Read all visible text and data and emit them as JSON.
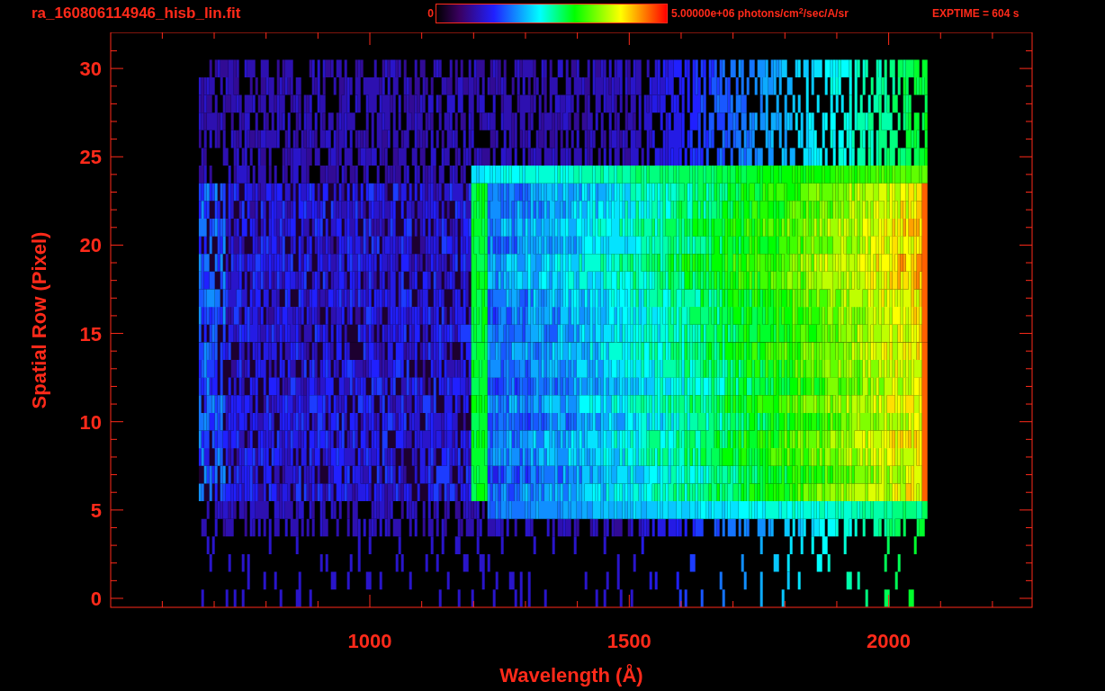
{
  "header": {
    "title": "ra_160806114946_hisb_lin.fit",
    "colorbar": {
      "min_label": "0",
      "max_label": "5.00000e+06 photons/cm$^{2}$/sec/A/sr"
    },
    "exptime": "EXPTIME = 604 s"
  },
  "plot": {
    "xlabel": "Wavelength (Å)",
    "ylabel": "Spatial Row (Pixel)",
    "xtick_labels": [
      "1000",
      "1500",
      "2000"
    ],
    "ytick_labels": [
      "30",
      "25",
      "20",
      "15",
      "10",
      "5",
      "0"
    ]
  }
}
